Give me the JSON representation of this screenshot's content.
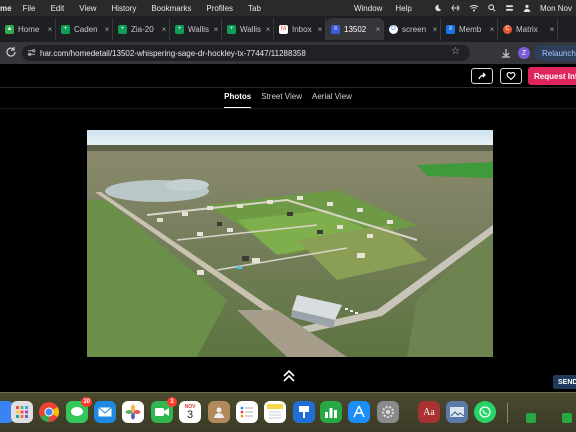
{
  "menubar": {
    "app": "me",
    "items": [
      "File",
      "Edit",
      "View",
      "History",
      "Bookmarks",
      "Profiles",
      "Tab",
      "Window",
      "Help"
    ],
    "clock": "Mon Nov"
  },
  "tabs": [
    {
      "label": "Home",
      "color": "#34a853",
      "active": false
    },
    {
      "label": "Caden",
      "color": "#0f9d58",
      "active": false
    },
    {
      "label": "Zia-20",
      "color": "#0f9d58",
      "active": false
    },
    {
      "label": "Wallis",
      "color": "#0f9d58",
      "active": false
    },
    {
      "label": "Wallis",
      "color": "#0f9d58",
      "active": false
    },
    {
      "label": "Inbox",
      "color": "#ea4335",
      "active": false
    },
    {
      "label": "13502",
      "color": "#3b5bdb",
      "active": true
    },
    {
      "label": "screen",
      "color": "#4285f4",
      "active": false
    },
    {
      "label": "Memb",
      "color": "#1a73e8",
      "active": false
    },
    {
      "label": "Matrix",
      "color": "#e8542f",
      "active": false
    }
  ],
  "address": {
    "url": "har.com/homedetail/13502-whispering-sage-dr-hockley-tx-77447/11288358"
  },
  "profile": {
    "initial": "Z"
  },
  "relaunch": {
    "label": "Relaunch t"
  },
  "page": {
    "request_label": "Request Info",
    "view_tabs": [
      {
        "label": "Photos",
        "active": true
      },
      {
        "label": "Street View",
        "active": false
      },
      {
        "label": "Aerial View",
        "active": false
      }
    ],
    "send_label": "SEND"
  },
  "dock": {
    "items": [
      {
        "name": "finder",
        "color": "#3b82f6",
        "glyph": ""
      },
      {
        "name": "launchpad",
        "color": "#d9d9d9",
        "glyph": ""
      },
      {
        "name": "chrome",
        "color": "#ffffff",
        "glyph": ""
      },
      {
        "name": "messages",
        "color": "#34c759",
        "glyph": "",
        "badge": "30"
      },
      {
        "name": "mail",
        "color": "#1e88e5",
        "glyph": ""
      },
      {
        "name": "photos",
        "color": "#ffffff",
        "glyph": ""
      },
      {
        "name": "facetime",
        "color": "#2fb84f",
        "glyph": "",
        "badge": "2"
      },
      {
        "name": "calendar",
        "color": "#ffffff",
        "glyph": "3",
        "month": "NOV"
      },
      {
        "name": "contacts",
        "color": "#b08a5a",
        "glyph": ""
      },
      {
        "name": "reminders",
        "color": "#ffffff",
        "glyph": ""
      },
      {
        "name": "notes",
        "color": "#f7d84a",
        "glyph": ""
      },
      {
        "name": "keynote",
        "color": "#1f6fd9",
        "glyph": ""
      },
      {
        "name": "numbers",
        "color": "#27a845",
        "glyph": ""
      },
      {
        "name": "app-store",
        "color": "#1c8ef9",
        "glyph": ""
      },
      {
        "name": "system-settings",
        "color": "#8a8a8a",
        "glyph": ""
      },
      {
        "name": "dictionary",
        "color": "#a83232",
        "glyph": "Aa"
      },
      {
        "name": "preview",
        "color": "#5b7aa8",
        "glyph": ""
      },
      {
        "name": "whatsapp",
        "color": "#25d366",
        "glyph": ""
      }
    ]
  }
}
